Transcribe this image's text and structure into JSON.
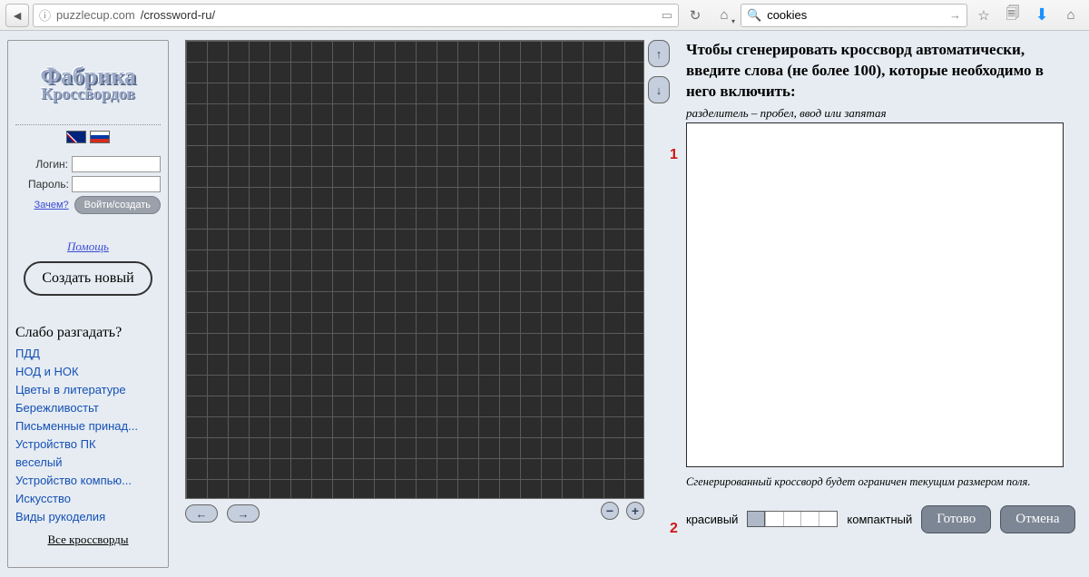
{
  "browser": {
    "url_host": "puzzlecup.com",
    "url_path": "/crossword-ru/",
    "search_value": "cookies"
  },
  "sidebar": {
    "logo_line1": "Фабрика",
    "logo_line2": "Кроссвордов",
    "login_label": "Логин:",
    "password_label": "Пароль:",
    "why_link": "Зачем?",
    "login_btn": "Войти/создать",
    "help_link": "Помощь",
    "create_btn": "Создать новый",
    "solve_title": "Слабо разгадать?",
    "links": [
      "ПДД",
      "НОД и НОК",
      "Цветы в литературе",
      "Бережливостьт",
      "Письменные принад...",
      "Устройство ПК",
      "веселый",
      "Устройство компью...",
      "Искусство",
      "Виды рукоделия"
    ],
    "all_link": "Все кроссворды"
  },
  "markers": {
    "one": "1",
    "two": "2"
  },
  "right": {
    "title": "Чтобы сгенерировать кроссворд автоматически, введите слова (не более 100), которые необходимо в него включить:",
    "hint": "разделитель – пробел, ввод или запятая",
    "note": "Сгенерированный кроссворд будет ограничен текущим размером поля.",
    "slider_left": "красивый",
    "slider_right": "компактный",
    "done_btn": "Готово",
    "cancel_btn": "Отмена"
  }
}
